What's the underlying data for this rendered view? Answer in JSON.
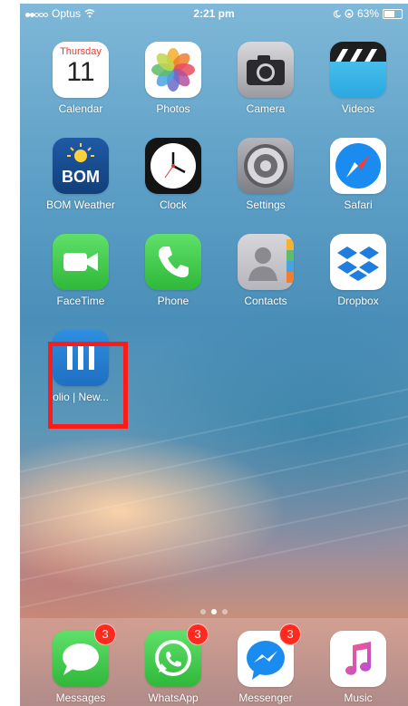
{
  "status_bar": {
    "carrier": "Optus",
    "time": "2:21 pm",
    "battery": "63%",
    "battery_fraction": 0.63
  },
  "apps": [
    {
      "label": "Calendar",
      "icon": "calendar-icon",
      "calendar_day": "Thursday",
      "calendar_date": "11"
    },
    {
      "label": "Photos",
      "icon": "photos-icon"
    },
    {
      "label": "Camera",
      "icon": "camera-icon"
    },
    {
      "label": "Videos",
      "icon": "videos-icon"
    },
    {
      "label": "BOM Weather",
      "icon": "bom-weather-icon",
      "icon_text": "BOM"
    },
    {
      "label": "Clock",
      "icon": "clock-icon"
    },
    {
      "label": "Settings",
      "icon": "settings-gear-icon"
    },
    {
      "label": "Safari",
      "icon": "safari-compass-icon"
    },
    {
      "label": "FaceTime",
      "icon": "facetime-icon"
    },
    {
      "label": "Phone",
      "icon": "phone-icon"
    },
    {
      "label": "Contacts",
      "icon": "contacts-icon"
    },
    {
      "label": "Dropbox",
      "icon": "dropbox-icon"
    },
    {
      "label": "olio | New...",
      "icon": "olio-icon"
    }
  ],
  "dock": [
    {
      "label": "Messages",
      "icon": "messages-icon",
      "badge": "3"
    },
    {
      "label": "WhatsApp",
      "icon": "whatsapp-icon",
      "badge": "3"
    },
    {
      "label": "Messenger",
      "icon": "messenger-icon",
      "badge": "3"
    },
    {
      "label": "Music",
      "icon": "music-icon"
    }
  ],
  "colors": {
    "badge": "#ff2a1f",
    "highlight": "#ff1a1a"
  }
}
